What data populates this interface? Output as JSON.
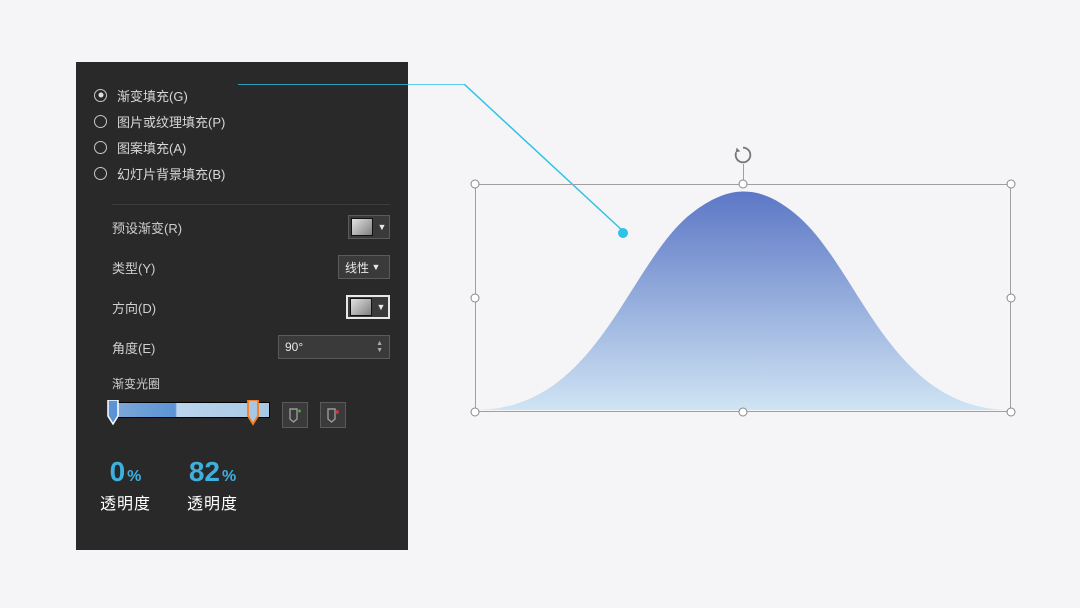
{
  "panel": {
    "radios": [
      {
        "label": "渐变填充(G)",
        "selected": true
      },
      {
        "label": "图片或纹理填充(P)",
        "selected": false
      },
      {
        "label": "图案填充(A)",
        "selected": false
      },
      {
        "label": "幻灯片背景填充(B)",
        "selected": false
      }
    ],
    "preset_label": "预设渐变(R)",
    "type_label": "类型(Y)",
    "type_value": "线性",
    "direction_label": "方向(D)",
    "angle_label": "角度(E)",
    "angle_value": "90°",
    "stops_label": "渐变光圈"
  },
  "annotations": {
    "left_value": "0",
    "left_pct": "%",
    "left_label": "透明度",
    "right_value": "82",
    "right_pct": "%",
    "right_label": "透明度"
  },
  "colors": {
    "accent_teal": "#2ec2e6",
    "grad_dark": "#5c77c6",
    "grad_light": "#cfe4f3"
  }
}
